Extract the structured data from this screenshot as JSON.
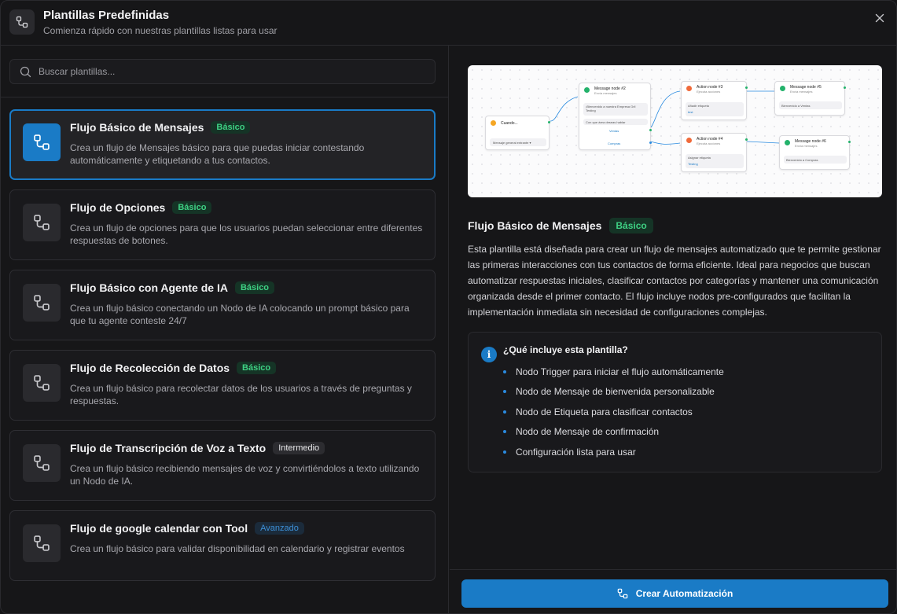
{
  "header": {
    "title": "Plantillas Predefinidas",
    "subtitle": "Comienza rápido con nuestras plantillas listas para usar"
  },
  "search": {
    "placeholder": "Buscar plantillas..."
  },
  "templates": [
    {
      "title": "Flujo Básico de Mensajes",
      "badge": "Básico",
      "level": "basico",
      "selected": true,
      "description": "Crea un flujo de Mensajes básico para que puedas iniciar contestando automáticamente y etiquetando a tus contactos."
    },
    {
      "title": "Flujo de Opciones",
      "badge": "Básico",
      "level": "basico",
      "selected": false,
      "description": "Crea un flujo de opciones para que los usuarios puedan seleccionar entre diferentes respuestas de botones."
    },
    {
      "title": "Flujo Básico con Agente de IA",
      "badge": "Básico",
      "level": "basico",
      "selected": false,
      "description": "Crea un flujo básico conectando un Nodo de IA colocando un prompt básico para que tu agente conteste 24/7"
    },
    {
      "title": "Flujo de Recolección de Datos",
      "badge": "Básico",
      "level": "basico",
      "selected": false,
      "description": "Crea un flujo básico para recolectar datos de los usuarios a través de preguntas y respuestas."
    },
    {
      "title": "Flujo de Transcripción de Voz a Texto",
      "badge": "Intermedio",
      "level": "intermedio",
      "selected": false,
      "description": "Crea un flujo básico recibiendo mensajes de voz y convirtiéndolos a texto utilizando un Nodo de IA."
    },
    {
      "title": "Flujo de google calendar con Tool",
      "badge": "Avanzado",
      "level": "avanzado",
      "selected": false,
      "description": "Crea un flujo básico para validar disponibilidad en calendario y registrar eventos"
    }
  ],
  "detail": {
    "title": "Flujo Básico de Mensajes",
    "badge": "Básico",
    "description": "Esta plantilla está diseñada para crear un flujo de mensajes automatizado que te permite gestionar las primeras interacciones con tus contactos de forma eficiente. Ideal para negocios que buscan automatizar respuestas iniciales, clasificar contactos por categorías y mantener una comunicación organizada desde el primer contacto. El flujo incluye nodos pre-configurados que facilitan la implementación inmediata sin necesidad de configuraciones complejas.",
    "includes_title": "¿Qué incluye esta plantilla?",
    "includes": [
      "Nodo Trigger para iniciar el flujo automáticamente",
      "Nodo de Mensaje de bienvenida personalizable",
      "Nodo de Etiqueta para clasificar contactos",
      "Nodo de Mensaje de confirmación",
      "Configuración lista para usar"
    ]
  },
  "preview": {
    "trigger": {
      "title": "Cuando...",
      "box": "Mensaje general entrante ▾"
    },
    "message2": {
      "title": "Message node #2",
      "sub": "Envía mensajes",
      "box1": "¡Bienvenido a nuestra Empresa Gril Testing",
      "box2": "Con que área deseas hablar",
      "link1": "Ventas",
      "link2": "Compras"
    },
    "action3": {
      "title": "Action node #3",
      "sub": "Ejecuta acciones",
      "box": "Añadir etiqueta",
      "box_val": "test"
    },
    "action4": {
      "title": "Action node #4",
      "sub": "Ejecuta acciones",
      "box": "Asignar etiqueta",
      "box_val": "Testing"
    },
    "message5": {
      "title": "Message node #5",
      "sub": "Envía mensajes",
      "box": "Bienvenido a Ventas"
    },
    "message6": {
      "title": "Message node #6",
      "sub": "Envía mensajes",
      "box": "Bienvenido a Compras"
    }
  },
  "footer": {
    "create_label": "Crear Automatización"
  },
  "colors": {
    "accent": "#1a7bc6",
    "basic_badge": "#3ed083",
    "advanced_badge": "#3d8fd6"
  },
  "icons": {
    "header": "flow-icon",
    "close": "close-icon",
    "search": "search-icon",
    "info": "info-icon"
  }
}
